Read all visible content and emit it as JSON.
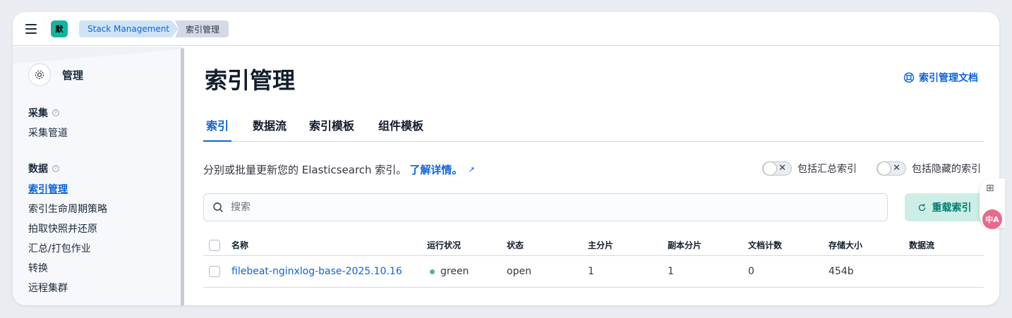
{
  "header": {
    "space_avatar": "默",
    "breadcrumbs": [
      "Stack Management",
      "索引管理"
    ]
  },
  "sidebar": {
    "title": "管理",
    "groups": [
      {
        "label": "采集",
        "items": [
          "采集管道"
        ]
      },
      {
        "label": "数据",
        "items": [
          "索引管理",
          "索引生命周期策略",
          "拍取快照并还原",
          "汇总/打包作业",
          "转换",
          "远程集群"
        ]
      }
    ],
    "active_item": "索引管理"
  },
  "main": {
    "title": "索引管理",
    "docs_link": "索引管理文档",
    "tabs": [
      "索引",
      "数据流",
      "索引模板",
      "组件模板"
    ],
    "active_tab": "索引",
    "description": "分别或批量更新您的 Elasticsearch 索引。",
    "learn_more": "了解详情。",
    "toggles": [
      {
        "label": "包括汇总索引",
        "on": false
      },
      {
        "label": "包括隐藏的索引",
        "on": false
      }
    ],
    "search_placeholder": "搜索",
    "reload_label": "重载索引"
  },
  "table": {
    "columns": [
      "名称",
      "运行状况",
      "状态",
      "主分片",
      "副本分片",
      "文档计数",
      "存储大小",
      "数据流"
    ],
    "rows": [
      {
        "name": "filebeat-nginxlog-base-2025.10.16",
        "health": "green",
        "status": "open",
        "primary": "1",
        "replicas": "1",
        "docs": "0",
        "size": "454b",
        "data_stream": ""
      }
    ]
  },
  "float": {
    "translate_label": "中A"
  },
  "colors": {
    "accent": "#0b64dd",
    "health_green": "#54b399",
    "reload_bg": "#cdeee6",
    "reload_text": "#017d73"
  }
}
